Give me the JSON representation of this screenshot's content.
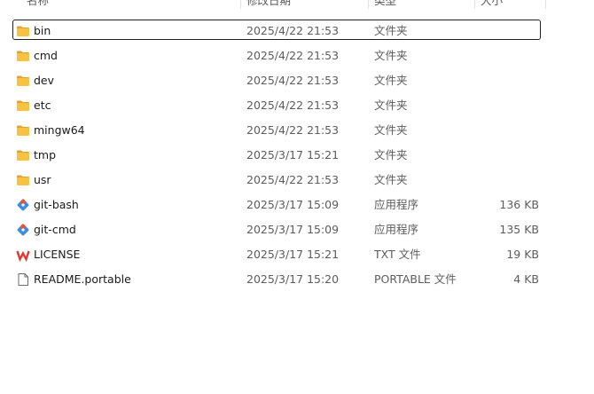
{
  "columns": {
    "name": "名称",
    "date": "修改日期",
    "type": "类型",
    "size": "大小"
  },
  "files": [
    {
      "name": "bin",
      "date": "2025/4/22 21:53",
      "type": "文件夹",
      "size": "",
      "icon": "folder-icon",
      "selected": true
    },
    {
      "name": "cmd",
      "date": "2025/4/22 21:53",
      "type": "文件夹",
      "size": "",
      "icon": "folder-icon"
    },
    {
      "name": "dev",
      "date": "2025/4/22 21:53",
      "type": "文件夹",
      "size": "",
      "icon": "folder-icon"
    },
    {
      "name": "etc",
      "date": "2025/4/22 21:53",
      "type": "文件夹",
      "size": "",
      "icon": "folder-icon"
    },
    {
      "name": "mingw64",
      "date": "2025/4/22 21:53",
      "type": "文件夹",
      "size": "",
      "icon": "folder-icon"
    },
    {
      "name": "tmp",
      "date": "2025/3/17 15:21",
      "type": "文件夹",
      "size": "",
      "icon": "folder-icon"
    },
    {
      "name": "usr",
      "date": "2025/4/22 21:53",
      "type": "文件夹",
      "size": "",
      "icon": "folder-icon"
    },
    {
      "name": "git-bash",
      "date": "2025/3/17 15:09",
      "type": "应用程序",
      "size": "136 KB",
      "icon": "git-app-icon"
    },
    {
      "name": "git-cmd",
      "date": "2025/3/17 15:09",
      "type": "应用程序",
      "size": "135 KB",
      "icon": "git-app-icon"
    },
    {
      "name": "LICENSE",
      "date": "2025/3/17 15:21",
      "type": "TXT 文件",
      "size": "19 KB",
      "icon": "wps-document-icon"
    },
    {
      "name": "README.portable",
      "date": "2025/3/17 15:20",
      "type": "PORTABLE 文件",
      "size": "4 KB",
      "icon": "blank-file-icon"
    }
  ],
  "colors": {
    "folder": "#F5C242",
    "folder_dark": "#E0A526",
    "git_red": "#E8513A",
    "git_blue": "#3E8EDB",
    "wps_red": "#E0362C",
    "selection_border": "#1F1F1F"
  }
}
